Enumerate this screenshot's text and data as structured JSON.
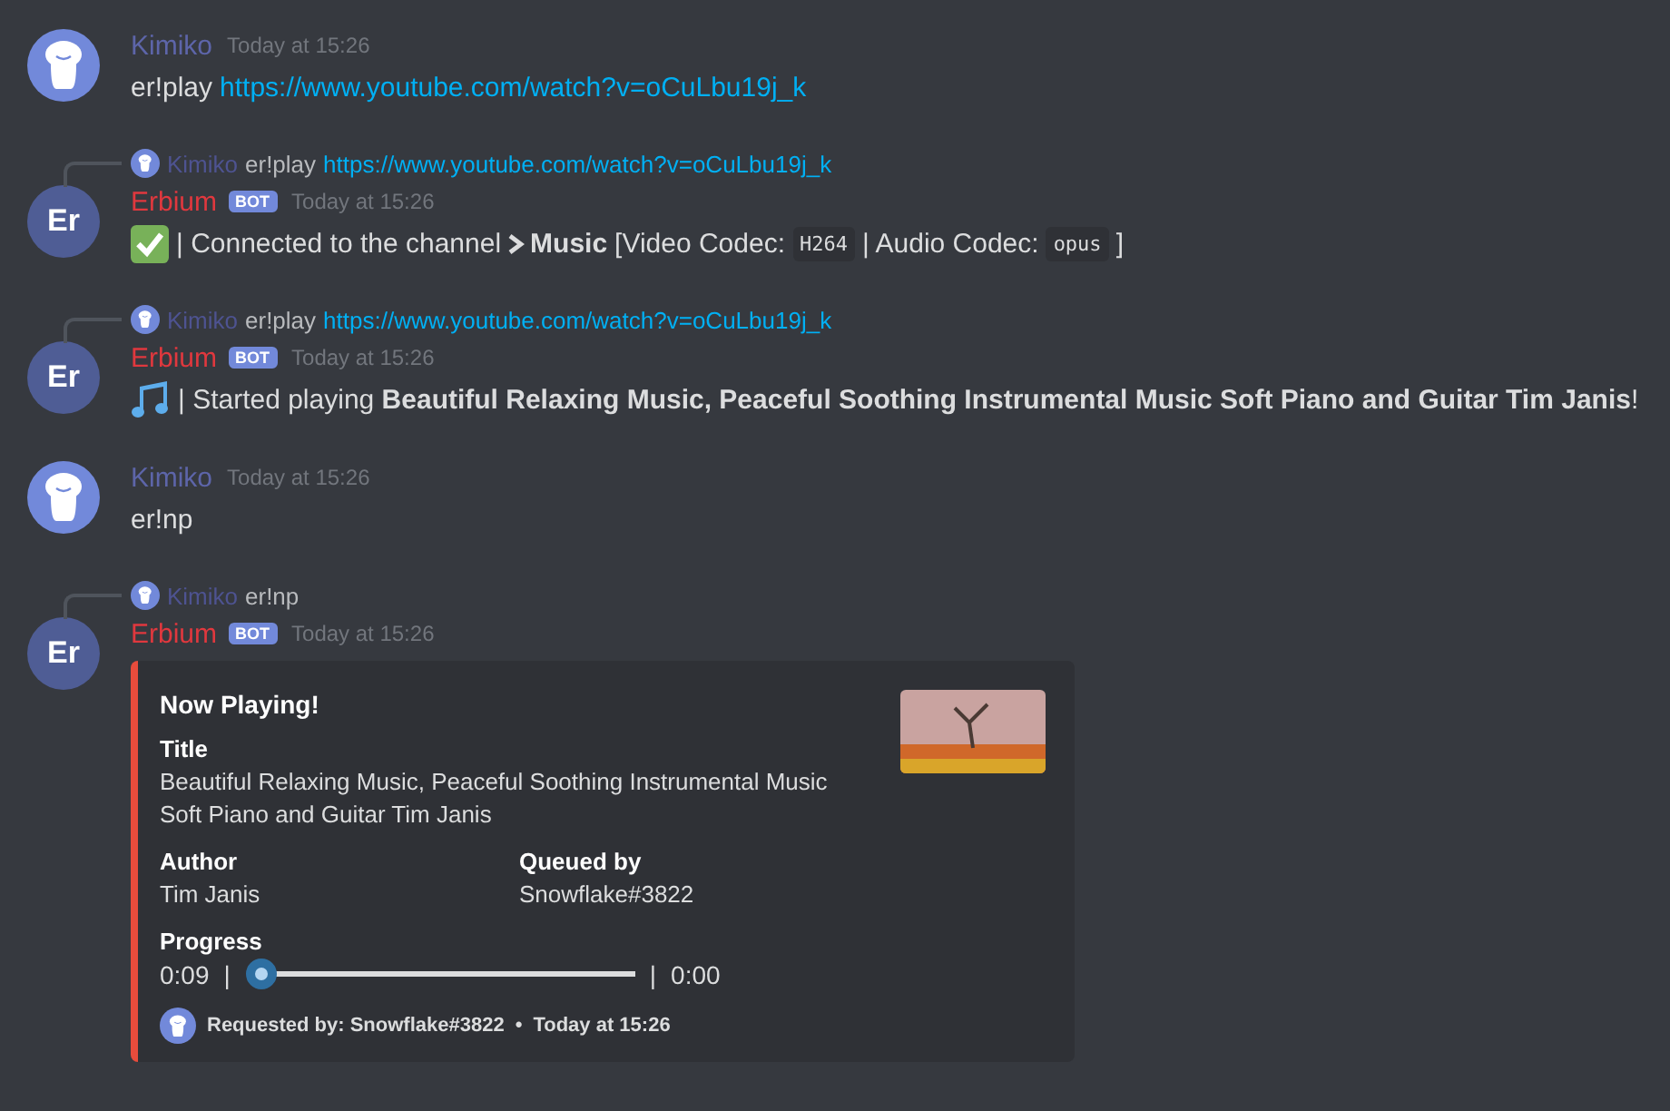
{
  "messages": [
    {
      "kind": "user",
      "author": {
        "name": "Kimiko",
        "color": "#5d65a9"
      },
      "timestamp": "Today at 15:26",
      "content": [
        {
          "kind": "text",
          "text": "er!play"
        },
        {
          "kind": "link",
          "text": "https://www.youtube.com/watch?v=oCuLbu19j_k"
        }
      ]
    },
    {
      "kind": "bot",
      "reply": {
        "author": "Kimiko",
        "content": [
          {
            "kind": "text",
            "text": "er!play"
          },
          {
            "kind": "link",
            "text": "https://www.youtube.com/watch?v=oCuLbu19j_k"
          }
        ]
      },
      "author": {
        "name": "Erbium",
        "color": "#e0383e",
        "initials": "Er"
      },
      "tag": "BOT",
      "timestamp": "Today at 15:26",
      "content": [
        {
          "kind": "check"
        },
        {
          "kind": "text",
          "text": "| Connected to the channel"
        },
        {
          "kind": "channel",
          "text": "Music"
        },
        {
          "kind": "text",
          "text": "[Video Codec:"
        },
        {
          "kind": "code",
          "text": "H264"
        },
        {
          "kind": "text",
          "text": "| Audio Codec:"
        },
        {
          "kind": "code",
          "text": "opus"
        },
        {
          "kind": "text",
          "text": "]"
        }
      ]
    },
    {
      "kind": "bot",
      "reply": {
        "author": "Kimiko",
        "content": [
          {
            "kind": "text",
            "text": "er!play"
          },
          {
            "kind": "link",
            "text": "https://www.youtube.com/watch?v=oCuLbu19j_k"
          }
        ]
      },
      "author": {
        "name": "Erbium",
        "color": "#e0383e",
        "initials": "Er"
      },
      "tag": "BOT",
      "timestamp": "Today at 15:26",
      "content": [
        {
          "kind": "notes"
        },
        {
          "kind": "text",
          "text": "| Started playing **Beautiful Relaxing Music, Peaceful Soothing Instrumental Music Soft Piano and Guitar Tim Janis**!"
        }
      ]
    },
    {
      "kind": "user",
      "author": {
        "name": "Kimiko",
        "color": "#5d65a9"
      },
      "timestamp": "Today at 15:26",
      "content": [
        {
          "kind": "text",
          "text": "er!np"
        }
      ]
    },
    {
      "kind": "bot",
      "reply": {
        "author": "Kimiko",
        "content": [
          {
            "kind": "text",
            "text": "er!np"
          }
        ]
      },
      "author": {
        "name": "Erbium",
        "color": "#e0383e",
        "initials": "Er"
      },
      "tag": "BOT",
      "timestamp": "Today at 15:26",
      "embed": {
        "color": "#e74c3c",
        "title": "Now Playing!",
        "fields": [
          {
            "name": "Title",
            "value": "Beautiful Relaxing Music, Peaceful Soothing Instrumental Music Soft Piano and Guitar Tim Janis"
          }
        ],
        "inline_fields": [
          {
            "name": "Author",
            "value": "Tim Janis"
          },
          {
            "name": "Queued by",
            "value": "Snowflake#3822"
          }
        ],
        "progress": {
          "name": "Progress",
          "elapsed": "0:09",
          "separator_left": "|",
          "separator_right": "|",
          "total": "0:00",
          "level": 0.0
        },
        "footer": {
          "text": "Requested by: Snowflake#3822",
          "separator": "•",
          "time": "Today at 15:26"
        }
      }
    }
  ]
}
